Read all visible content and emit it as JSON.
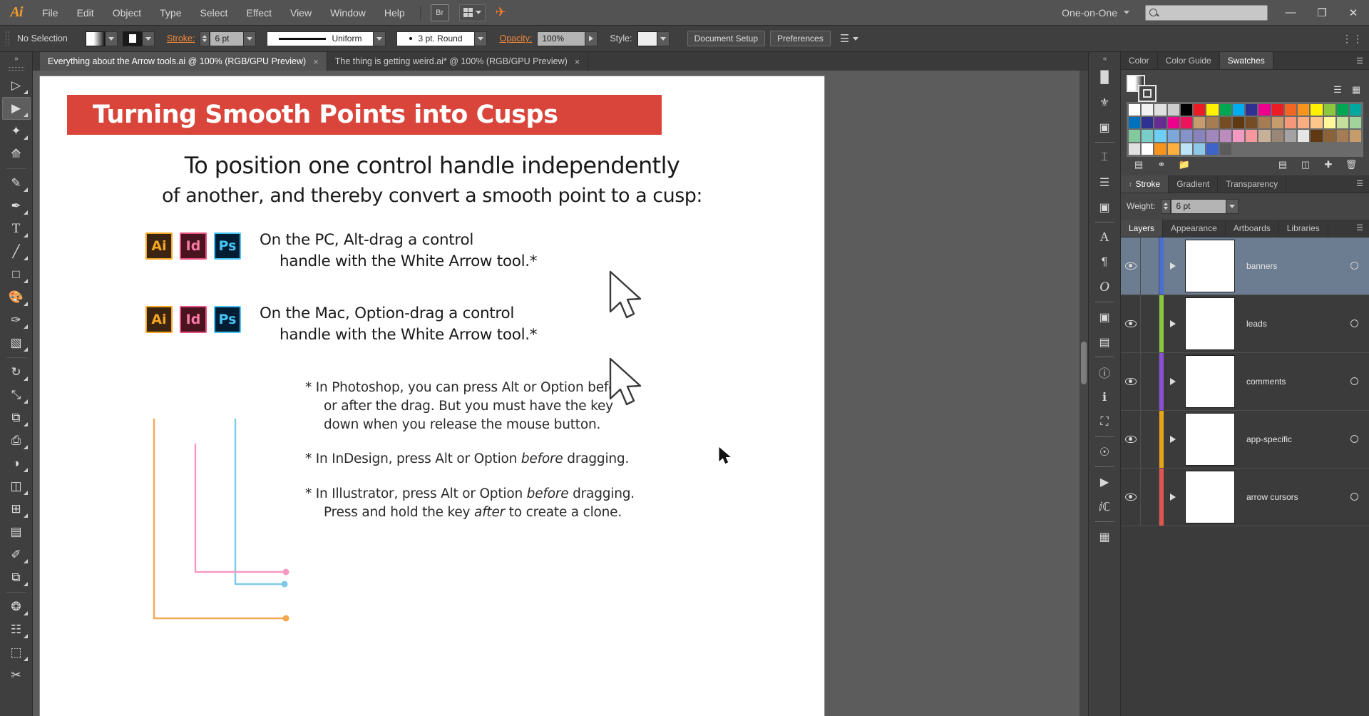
{
  "app": {
    "name": "Adobe Illustrator",
    "logo": "Ai"
  },
  "menubar": {
    "items": [
      "File",
      "Edit",
      "Object",
      "Type",
      "Select",
      "Effect",
      "View",
      "Window",
      "Help"
    ],
    "bridge_label": "Br",
    "workspace": "One-on-One",
    "search_placeholder": "",
    "search_value": ""
  },
  "controlbar": {
    "selection_status": "No Selection",
    "stroke_label": "Stroke:",
    "stroke_weight": "6 pt",
    "profile": "Uniform",
    "brush": "3 pt. Round",
    "opacity_label": "Opacity:",
    "opacity_value": "100%",
    "style_label": "Style:",
    "document_setup": "Document Setup",
    "preferences": "Preferences"
  },
  "tabs": [
    {
      "title": "Everything about the Arrow tools.ai @ 100% (RGB/GPU Preview)",
      "active": true,
      "close": "×"
    },
    {
      "title": "The thing is getting weird.ai* @ 100% (RGB/GPU Preview)",
      "active": false,
      "close": "×"
    }
  ],
  "toolbar": {
    "tools": [
      {
        "name": "selection-tool",
        "glyph": "➤",
        "active": false
      },
      {
        "name": "direct-selection-tool",
        "glyph": "➤",
        "active": true
      },
      {
        "name": "magic-wand-tool",
        "glyph": "✦",
        "active": false
      },
      {
        "name": "lasso-tool",
        "glyph": "❀",
        "active": false
      },
      {
        "name": "pen-tool",
        "glyph": "✒",
        "active": false
      },
      {
        "name": "curvature-tool",
        "glyph": "✎",
        "active": false
      },
      {
        "name": "type-tool",
        "glyph": "T",
        "active": false
      },
      {
        "name": "line-segment-tool",
        "glyph": "╱",
        "active": false
      },
      {
        "name": "rectangle-tool",
        "glyph": "□",
        "active": false
      },
      {
        "name": "paintbrush-tool",
        "glyph": "ᴧ",
        "active": false
      },
      {
        "name": "shaper-tool",
        "glyph": "✒",
        "active": false
      },
      {
        "name": "eraser-tool",
        "glyph": "◧",
        "active": false
      },
      {
        "name": "rotate-tool",
        "glyph": "↻",
        "active": false
      },
      {
        "name": "scale-tool",
        "glyph": "⤡",
        "active": false
      },
      {
        "name": "width-tool",
        "glyph": "⧉",
        "active": false
      },
      {
        "name": "free-transform-tool",
        "glyph": "⌗",
        "active": false
      },
      {
        "name": "shape-builder-tool",
        "glyph": "◑",
        "active": false
      },
      {
        "name": "perspective-grid-tool",
        "glyph": "◫",
        "active": false
      },
      {
        "name": "mesh-tool",
        "glyph": "⊞",
        "active": false
      },
      {
        "name": "gradient-tool",
        "glyph": "▤",
        "active": false
      },
      {
        "name": "eyedropper-tool",
        "glyph": "✐",
        "active": false
      },
      {
        "name": "blend-tool",
        "glyph": "⧉",
        "active": false
      },
      {
        "name": "symbol-sprayer-tool",
        "glyph": "⁂",
        "active": false
      },
      {
        "name": "column-graph-tool",
        "glyph": "☷",
        "active": false
      },
      {
        "name": "artboard-tool",
        "glyph": "⬚",
        "active": false
      },
      {
        "name": "slice-tool",
        "glyph": "✀",
        "active": false
      }
    ]
  },
  "slide": {
    "banner_title": "Turning Smooth Points into Cusps",
    "lead_line1": "To position one control handle independently",
    "lead_line2": "of another, and thereby convert a smooth point to a cusp:",
    "rows": [
      {
        "badges": [
          "Ai",
          "Id",
          "Ps"
        ],
        "line1": "On the PC, Alt-drag a control",
        "line2": "handle with the White Arrow tool.*"
      },
      {
        "badges": [
          "Ai",
          "Id",
          "Ps"
        ],
        "line1": "On the Mac, Option-drag a control",
        "line2": "handle with the White Arrow tool.*"
      }
    ],
    "footnotes": [
      {
        "l1": "* In Photoshop, you can press Alt or Option before",
        "l2": "or after the drag. But you must have the key",
        "l3": "down when you release the mouse button."
      },
      {
        "pre": "* In InDesign, press Alt or Option ",
        "em": "before",
        "post": " dragging."
      },
      {
        "pre": "* In Illustrator, press Alt or Option ",
        "em": "before",
        "post": " dragging.",
        "l2pre": "Press and hold the key ",
        "l2em": "after",
        "l2post": " to create a clone."
      }
    ]
  },
  "panels": {
    "color_group": {
      "tabs": [
        "Color",
        "Color Guide",
        "Swatches"
      ],
      "active": "Swatches",
      "swatch_colors": [
        "#ffffff",
        "#f2f2f2",
        "#e0e0e0",
        "#cccccc",
        "#000000",
        "#ed1c24",
        "#fff200",
        "#00a651",
        "#00aeef",
        "#2e3192",
        "#ec008c",
        "#ed1c24",
        "#f26522",
        "#f7941d",
        "#fff200",
        "#8dc63f",
        "#00a651",
        "#00a99d",
        "#0071bc",
        "#2e3192",
        "#662d91",
        "#ec008c",
        "#ed145b",
        "#c69c6d",
        "#a67c52",
        "#754c24",
        "#603913",
        "#754c24",
        "#a67c52",
        "#c69c6d",
        "#f7977a",
        "#f9ad81",
        "#fdc68a",
        "#fff79a",
        "#c4df9b",
        "#a2d39c",
        "#82ca9d",
        "#7bcdc8",
        "#6ecff6",
        "#7da7d9",
        "#8493ca",
        "#8882be",
        "#a187be",
        "#bd8cbf",
        "#f49ac2",
        "#f6989d",
        "#c7b299",
        "#998675",
        "#a3a3a3",
        "#e6e6e6",
        "#603913",
        "#8c6239",
        "#a67c52",
        "#c69c6d",
        "#e0e0e0",
        "#ffffff",
        "#f7941d",
        "#fbb040",
        "#bce4f6",
        "#8ec8e8",
        "#3e64c9",
        "#5b5b5b"
      ],
      "footer_icons": [
        "library-icon",
        "link-icon",
        "folder-icon",
        "options-icon",
        "new-swatch-icon",
        "delete-icon"
      ]
    },
    "stroke_group": {
      "tabs": [
        "Stroke",
        "Gradient",
        "Transparency"
      ],
      "active": "Stroke",
      "weight_label": "Weight:",
      "weight_value": "6 pt"
    },
    "layers_group": {
      "tabs": [
        "Layers",
        "Appearance",
        "Artboards",
        "Libraries"
      ],
      "active": "Layers",
      "rows": [
        {
          "name": "banners",
          "color": "#4a6fd4",
          "selected": true,
          "visible": true,
          "expanded": false
        },
        {
          "name": "leads",
          "color": "#8cc63f",
          "selected": false,
          "visible": true,
          "expanded": false
        },
        {
          "name": "comments",
          "color": "#8a4fd4",
          "selected": false,
          "visible": true,
          "expanded": false
        },
        {
          "name": "app-specific",
          "color": "#e8a317",
          "selected": false,
          "visible": true,
          "expanded": false
        },
        {
          "name": "arrow cursors",
          "color": "#e0554f",
          "selected": false,
          "visible": true,
          "expanded": false
        }
      ]
    }
  },
  "colors": {
    "banner_red": "#d9453a",
    "chrome_dark": "#3f3f3f",
    "chrome_menu": "#535353",
    "canvas_gray": "#5c5c5c",
    "accent_orange": "#f0873b",
    "layer_selected": "#6c7c91"
  }
}
